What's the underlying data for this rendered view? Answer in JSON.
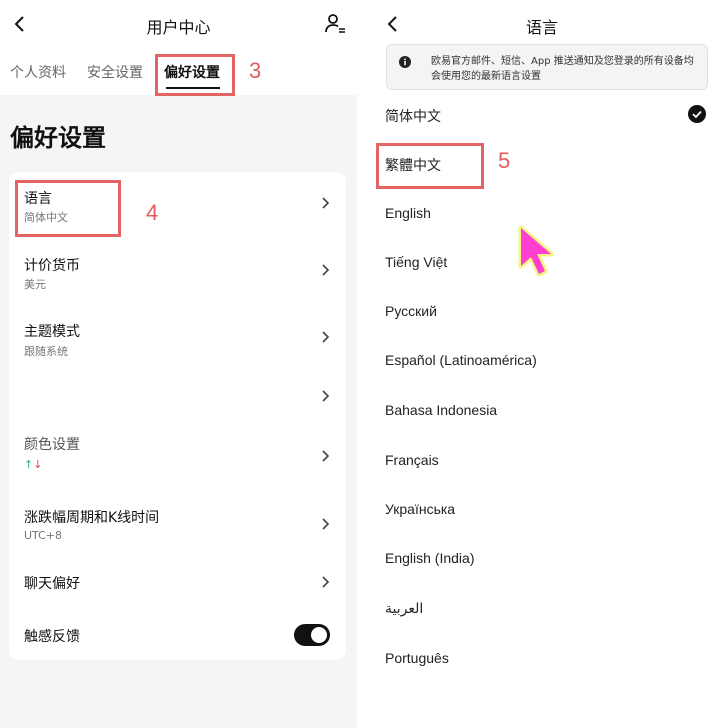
{
  "left": {
    "title": "用户中心",
    "tabs": [
      {
        "label": "个人资料"
      },
      {
        "label": "安全设置"
      },
      {
        "label": "偏好设置"
      }
    ],
    "heading": "偏好设置",
    "rows": [
      {
        "title": "语言",
        "sub": "简体中文"
      },
      {
        "title": "计价货币",
        "sub": "美元"
      },
      {
        "title": "主题模式",
        "sub": "跟随系统"
      },
      {
        "title": "",
        "sub": ""
      },
      {
        "title": "颜色设置",
        "sub": ""
      },
      {
        "title": "涨跌幅周期和K线时间",
        "sub": "UTC+8"
      },
      {
        "title": "聊天偏好",
        "sub": ""
      },
      {
        "title": "触感反馈",
        "sub": ""
      }
    ],
    "color_arrows": {
      "up": "↑",
      "down": "↓"
    },
    "toggle_on": true
  },
  "right": {
    "title": "语言",
    "notice": "欧易官方邮件、短信、App 推送通知及您登录的所有设备均会使用您的最新语言设置",
    "languages": [
      "简体中文",
      "繁體中文",
      "English",
      "Tiếng Việt",
      "Русский",
      "Español (Latinoamérica)",
      "Bahasa Indonesia",
      "Français",
      "Українська",
      "English (India)",
      "العربية",
      "Português"
    ],
    "selected": "简体中文"
  },
  "annotations": {
    "a3": "3",
    "a4": "4",
    "a5": "5"
  },
  "colors": {
    "annotation": "#e36464",
    "cursor": "#ff3fd0",
    "cursor_glow": "#f4f25a"
  }
}
